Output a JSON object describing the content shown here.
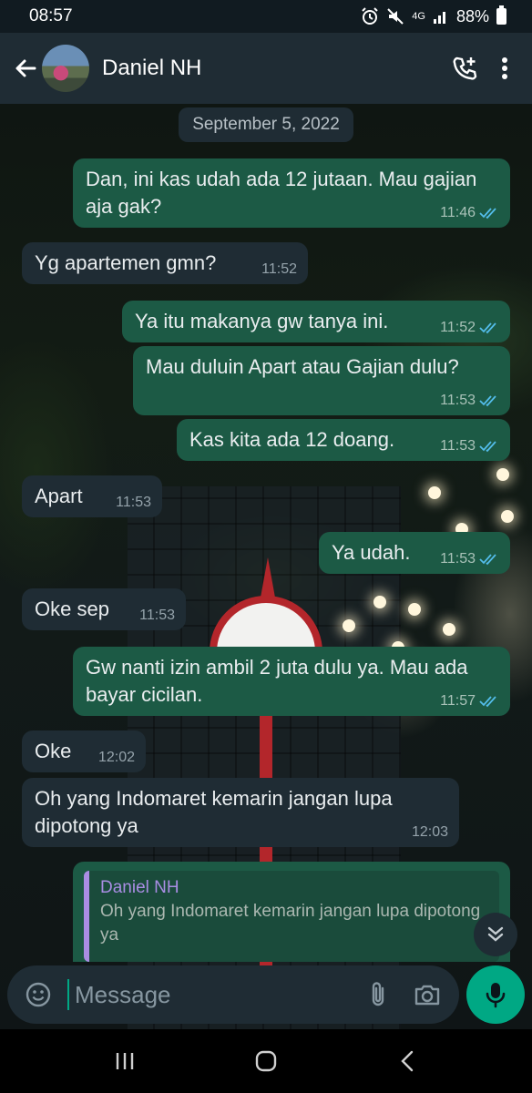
{
  "status_bar": {
    "time": "08:57",
    "network": "4G",
    "battery": "88%"
  },
  "header": {
    "contact_name": "Daniel NH",
    "icons": [
      "back-arrow-icon",
      "add-call-icon",
      "more-vert-icon"
    ]
  },
  "chat": {
    "date_label": "September 5, 2022",
    "messages": [
      {
        "direction": "out",
        "text": "Dan, ini kas udah ada 12  jutaan. Mau gajian aja gak?",
        "time": "11:46",
        "status": "read"
      },
      {
        "direction": "in",
        "text": "Yg apartemen gmn?",
        "time": "11:52"
      },
      {
        "direction": "out",
        "text": "Ya itu makanya gw tanya ini.",
        "time": "11:52",
        "status": "read"
      },
      {
        "direction": "out",
        "text": "Mau duluin Apart atau Gajian dulu?",
        "time": "11:53",
        "status": "read"
      },
      {
        "direction": "out",
        "text": "Kas kita ada 12 doang.",
        "time": "11:53",
        "status": "read"
      },
      {
        "direction": "in",
        "text": "Apart",
        "time": "11:53"
      },
      {
        "direction": "out",
        "text": "Ya udah.",
        "time": "11:53",
        "status": "read"
      },
      {
        "direction": "in",
        "text": "Oke sep",
        "time": "11:53"
      },
      {
        "direction": "out",
        "text": "Gw nanti izin ambil 2 juta dulu ya. Mau ada bayar cicilan.",
        "time": "11:57",
        "status": "read"
      },
      {
        "direction": "in",
        "text": "Oke",
        "time": "12:02"
      },
      {
        "direction": "in",
        "text": "Oh yang Indomaret kemarin jangan lupa dipotong ya",
        "time": "12:03"
      }
    ],
    "reply_preview": {
      "author": "Daniel NH",
      "text": "Oh yang Indomaret kemarin jangan lupa dipotong ya"
    }
  },
  "composer": {
    "placeholder": "Message"
  },
  "colors": {
    "outgoing_bubble": "#1c5a45",
    "incoming_bubble": "#1f2c34",
    "accent": "#00a884",
    "read_tick": "#53bdeb",
    "reply_author": "#a98de3"
  }
}
